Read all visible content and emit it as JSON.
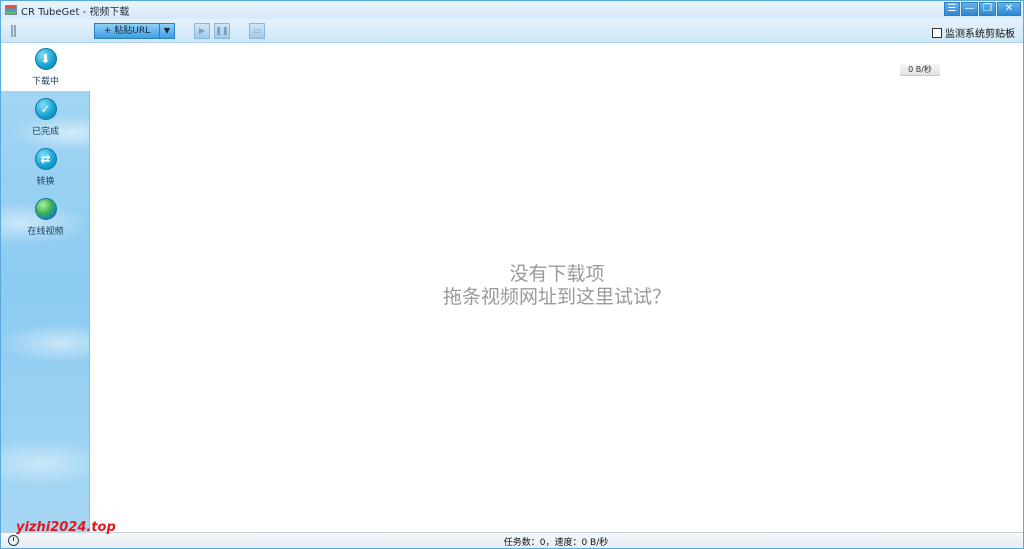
{
  "window": {
    "title": "CR TubeGet - 视频下载"
  },
  "window_controls": {
    "menu_icon": "menu-icon",
    "minimize_icon": "minimize-icon",
    "restore_icon": "restore-icon",
    "close_icon": "close-icon"
  },
  "toolbar": {
    "paste_url_label": "+ 粘贴URL",
    "dropdown_icon": "dropdown-arrow-icon",
    "buttons": [
      "play-icon",
      "pause-icon",
      "settings-icon"
    ],
    "monitor_clipboard_label": "监测系统剪贴板",
    "monitor_clipboard_checked": false
  },
  "sidebar": {
    "items": [
      {
        "label": "下载中",
        "icon": "download-icon",
        "active": true
      },
      {
        "label": "已完成",
        "icon": "check-icon",
        "active": false
      },
      {
        "label": "转换",
        "icon": "convert-icon",
        "active": false
      },
      {
        "label": "在线视频",
        "icon": "globe-icon",
        "active": false
      }
    ]
  },
  "main": {
    "speed": "0 B/秒",
    "empty_line1": "没有下载项",
    "empty_line2": "拖条视频网址到这里试试？"
  },
  "statusbar": {
    "text": "任务数：0，速度：0 B/秒"
  },
  "watermark": "yizhi2024.top"
}
